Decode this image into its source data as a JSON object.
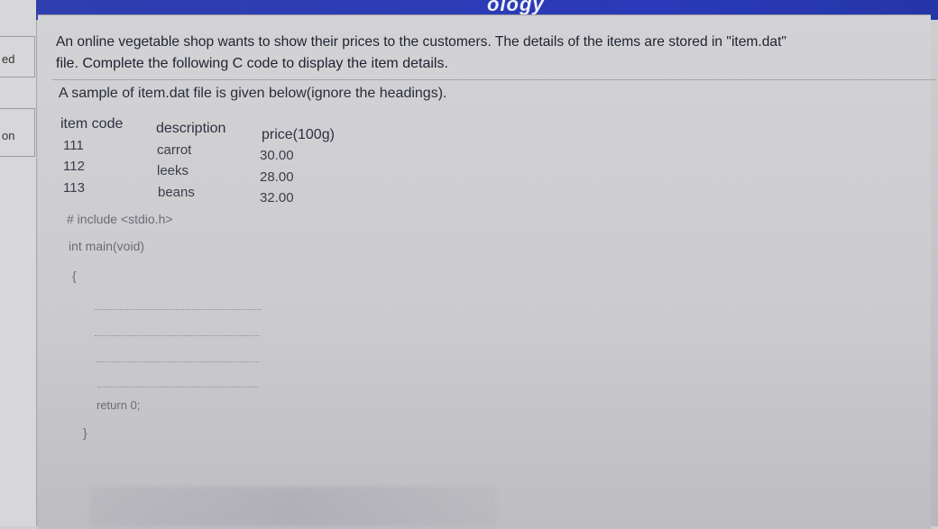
{
  "header": {
    "title_fragment": "ology"
  },
  "sidebar": {
    "labels": [
      "ed",
      "on"
    ]
  },
  "question": {
    "line1": "An online vegetable shop wants to show their prices to the customers. The details of the items are stored in \"item.dat\"",
    "line2": "file. Complete the following C code to display the item details.",
    "sample_note": "A sample of item.dat file is given below(ignore the headings)."
  },
  "table": {
    "headers": [
      "item code",
      "description",
      "price(100g)"
    ],
    "rows": [
      [
        "111",
        "carrot",
        "30.00"
      ],
      [
        "112",
        "leeks",
        "28.00"
      ],
      [
        "113",
        "beans",
        "32.00"
      ]
    ]
  },
  "code": {
    "include": "# include <stdio.h>",
    "main": "int main(void)",
    "open_brace": "{",
    "return": "return 0;",
    "close_brace": "}"
  }
}
